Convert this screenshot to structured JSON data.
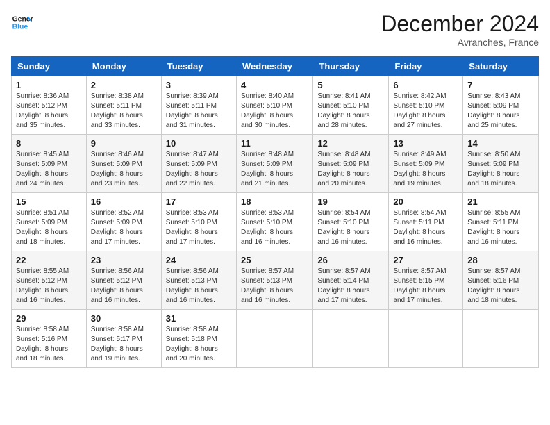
{
  "logo": {
    "text_general": "General",
    "text_blue": "Blue"
  },
  "header": {
    "month": "December 2024",
    "location": "Avranches, France"
  },
  "weekdays": [
    "Sunday",
    "Monday",
    "Tuesday",
    "Wednesday",
    "Thursday",
    "Friday",
    "Saturday"
  ],
  "weeks": [
    [
      {
        "day": "1",
        "info": "Sunrise: 8:36 AM\nSunset: 5:12 PM\nDaylight: 8 hours\nand 35 minutes."
      },
      {
        "day": "2",
        "info": "Sunrise: 8:38 AM\nSunset: 5:11 PM\nDaylight: 8 hours\nand 33 minutes."
      },
      {
        "day": "3",
        "info": "Sunrise: 8:39 AM\nSunset: 5:11 PM\nDaylight: 8 hours\nand 31 minutes."
      },
      {
        "day": "4",
        "info": "Sunrise: 8:40 AM\nSunset: 5:10 PM\nDaylight: 8 hours\nand 30 minutes."
      },
      {
        "day": "5",
        "info": "Sunrise: 8:41 AM\nSunset: 5:10 PM\nDaylight: 8 hours\nand 28 minutes."
      },
      {
        "day": "6",
        "info": "Sunrise: 8:42 AM\nSunset: 5:10 PM\nDaylight: 8 hours\nand 27 minutes."
      },
      {
        "day": "7",
        "info": "Sunrise: 8:43 AM\nSunset: 5:09 PM\nDaylight: 8 hours\nand 25 minutes."
      }
    ],
    [
      {
        "day": "8",
        "info": "Sunrise: 8:45 AM\nSunset: 5:09 PM\nDaylight: 8 hours\nand 24 minutes."
      },
      {
        "day": "9",
        "info": "Sunrise: 8:46 AM\nSunset: 5:09 PM\nDaylight: 8 hours\nand 23 minutes."
      },
      {
        "day": "10",
        "info": "Sunrise: 8:47 AM\nSunset: 5:09 PM\nDaylight: 8 hours\nand 22 minutes."
      },
      {
        "day": "11",
        "info": "Sunrise: 8:48 AM\nSunset: 5:09 PM\nDaylight: 8 hours\nand 21 minutes."
      },
      {
        "day": "12",
        "info": "Sunrise: 8:48 AM\nSunset: 5:09 PM\nDaylight: 8 hours\nand 20 minutes."
      },
      {
        "day": "13",
        "info": "Sunrise: 8:49 AM\nSunset: 5:09 PM\nDaylight: 8 hours\nand 19 minutes."
      },
      {
        "day": "14",
        "info": "Sunrise: 8:50 AM\nSunset: 5:09 PM\nDaylight: 8 hours\nand 18 minutes."
      }
    ],
    [
      {
        "day": "15",
        "info": "Sunrise: 8:51 AM\nSunset: 5:09 PM\nDaylight: 8 hours\nand 18 minutes."
      },
      {
        "day": "16",
        "info": "Sunrise: 8:52 AM\nSunset: 5:09 PM\nDaylight: 8 hours\nand 17 minutes."
      },
      {
        "day": "17",
        "info": "Sunrise: 8:53 AM\nSunset: 5:10 PM\nDaylight: 8 hours\nand 17 minutes."
      },
      {
        "day": "18",
        "info": "Sunrise: 8:53 AM\nSunset: 5:10 PM\nDaylight: 8 hours\nand 16 minutes."
      },
      {
        "day": "19",
        "info": "Sunrise: 8:54 AM\nSunset: 5:10 PM\nDaylight: 8 hours\nand 16 minutes."
      },
      {
        "day": "20",
        "info": "Sunrise: 8:54 AM\nSunset: 5:11 PM\nDaylight: 8 hours\nand 16 minutes."
      },
      {
        "day": "21",
        "info": "Sunrise: 8:55 AM\nSunset: 5:11 PM\nDaylight: 8 hours\nand 16 minutes."
      }
    ],
    [
      {
        "day": "22",
        "info": "Sunrise: 8:55 AM\nSunset: 5:12 PM\nDaylight: 8 hours\nand 16 minutes."
      },
      {
        "day": "23",
        "info": "Sunrise: 8:56 AM\nSunset: 5:12 PM\nDaylight: 8 hours\nand 16 minutes."
      },
      {
        "day": "24",
        "info": "Sunrise: 8:56 AM\nSunset: 5:13 PM\nDaylight: 8 hours\nand 16 minutes."
      },
      {
        "day": "25",
        "info": "Sunrise: 8:57 AM\nSunset: 5:13 PM\nDaylight: 8 hours\nand 16 minutes."
      },
      {
        "day": "26",
        "info": "Sunrise: 8:57 AM\nSunset: 5:14 PM\nDaylight: 8 hours\nand 17 minutes."
      },
      {
        "day": "27",
        "info": "Sunrise: 8:57 AM\nSunset: 5:15 PM\nDaylight: 8 hours\nand 17 minutes."
      },
      {
        "day": "28",
        "info": "Sunrise: 8:57 AM\nSunset: 5:16 PM\nDaylight: 8 hours\nand 18 minutes."
      }
    ],
    [
      {
        "day": "29",
        "info": "Sunrise: 8:58 AM\nSunset: 5:16 PM\nDaylight: 8 hours\nand 18 minutes."
      },
      {
        "day": "30",
        "info": "Sunrise: 8:58 AM\nSunset: 5:17 PM\nDaylight: 8 hours\nand 19 minutes."
      },
      {
        "day": "31",
        "info": "Sunrise: 8:58 AM\nSunset: 5:18 PM\nDaylight: 8 hours\nand 20 minutes."
      },
      null,
      null,
      null,
      null
    ]
  ]
}
